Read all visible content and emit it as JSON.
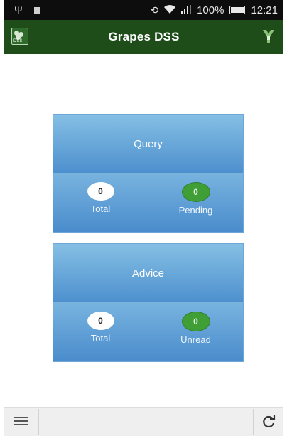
{
  "status_bar": {
    "battery": "100%",
    "time": "12:21",
    "icons": [
      "usb-icon",
      "notification-square-icon",
      "rotate-icon",
      "wifi-icon",
      "signal-icon",
      "battery-icon"
    ]
  },
  "app_bar": {
    "title": "Grapes DSS",
    "logo_text": "DSS",
    "left_icon": "app-logo-icon",
    "right_icon": "app-badge-icon",
    "color": "#1e4d1a"
  },
  "cards": [
    {
      "title": "Query",
      "stats": [
        {
          "value": "0",
          "label": "Total",
          "badge_color": "#ffffff"
        },
        {
          "value": "0",
          "label": "Pending",
          "badge_color": "#3f9f36"
        }
      ]
    },
    {
      "title": "Advice",
      "stats": [
        {
          "value": "0",
          "label": "Total",
          "badge_color": "#ffffff"
        },
        {
          "value": "0",
          "label": "Unread",
          "badge_color": "#3f9f36"
        }
      ]
    }
  ],
  "bottom_bar": {
    "icons": [
      "menu-icon",
      "refresh-icon"
    ]
  }
}
